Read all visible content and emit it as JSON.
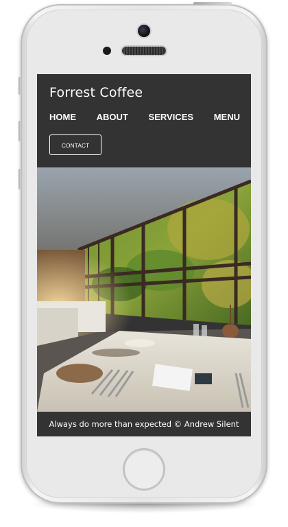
{
  "site": {
    "brand": "Forrest Coffee",
    "nav": [
      {
        "label": "HOME"
      },
      {
        "label": "ABOUT"
      },
      {
        "label": "SERVICES"
      },
      {
        "label": "MENU"
      }
    ],
    "contact_label": "CONTACT",
    "footer_text": "Always do more than expected © Andrew Silent"
  },
  "colors": {
    "header_bg": "#333333",
    "text": "#ffffff",
    "phone_body": "#e9e9e9"
  },
  "hero": {
    "description": "restaurant dining room photo"
  }
}
